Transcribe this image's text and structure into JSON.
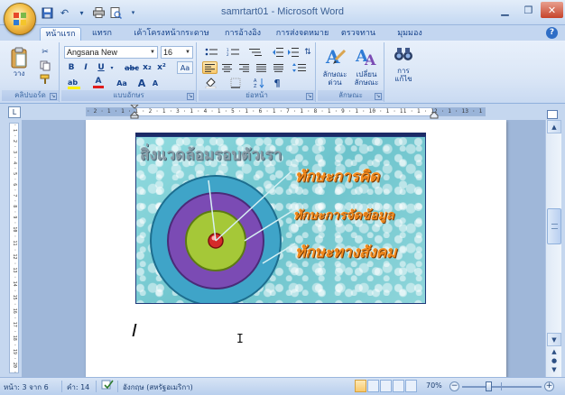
{
  "window": {
    "title": "samrtart01 - Microsoft Word",
    "controls": [
      "minimize",
      "maximize",
      "close"
    ]
  },
  "quick_access": [
    "save-icon",
    "undo-icon",
    "redo-icon",
    "print-icon",
    "print-preview-icon",
    "customize-icon"
  ],
  "tabs": [
    "หน้าแรก",
    "แทรก",
    "เค้าโครงหน้ากระดาษ",
    "การอ้างอิง",
    "การส่งจดหมาย",
    "ตรวจทาน",
    "มุมมอง"
  ],
  "active_tab": "หน้าแรก",
  "ribbon": {
    "clipboard": {
      "paste_label": "วาง",
      "group_label": "คลิปบอร์ด"
    },
    "font": {
      "font_name": "Angsana New",
      "font_size": "16",
      "bold": "B",
      "italic": "I",
      "underline": "U",
      "strike": "abc",
      "subscript": "x₂",
      "superscript": "x²",
      "clear_format": "Aa",
      "text_color": "A",
      "change_case": "Aa",
      "grow_font": "A",
      "shrink_font": "A",
      "group_label": "แบบอักษร"
    },
    "paragraph": {
      "group_label": "ย่อหน้า",
      "pilcrow": "¶"
    },
    "styles": {
      "quick_styles_label": "ลักษณะ\nด่วน",
      "change_styles_label": "เปลี่ยน\nลักษณะ",
      "group_label": "ลักษณะ"
    },
    "editing": {
      "label": "การ\nแก้ไข"
    }
  },
  "ruler": {
    "ticks": "· 2 · 1 · 1 · 1 · 2 · 1 · 3 · 1 · 4 · 1 · 5 · 1 · 6 · 1 · 7 · 1 · 8 · 1 · 9 · 1 · 10 · 1 · 11 · 1 · 12 · 1 · 13 · 1 · 14 · 1 · 15 · 1 · 16 · 1 · 17 · 18 ·",
    "vticks": "· 1 · 2 · 3 · 4 · 5 · 6 · 7 · 8 · 9 · 10 · 11 · 12 · 13 · 14 · 15 · 16 · 17 · 18 · 19 · 20 · 21 · 22 · 23 · 24 · 25 · 26 · 27"
  },
  "document": {
    "picture": {
      "title": "สิ่งแวดล้อมรอบตัวเรา",
      "labels": [
        "ทักษะการคิด",
        "ทักษะการจัดข้อมูล",
        "ทักษะทางสังคม"
      ],
      "ring_colors": [
        "#3fa4c8",
        "#7b4bb4",
        "#a5c838",
        "#d42a2a"
      ]
    }
  },
  "statusbar": {
    "page": "หน้า: 3 จาก 6",
    "words": "คำ: 14",
    "language": "อังกฤษ (สหรัฐอเมริกา)",
    "zoom": "70%",
    "zoom_level": 0.7
  }
}
